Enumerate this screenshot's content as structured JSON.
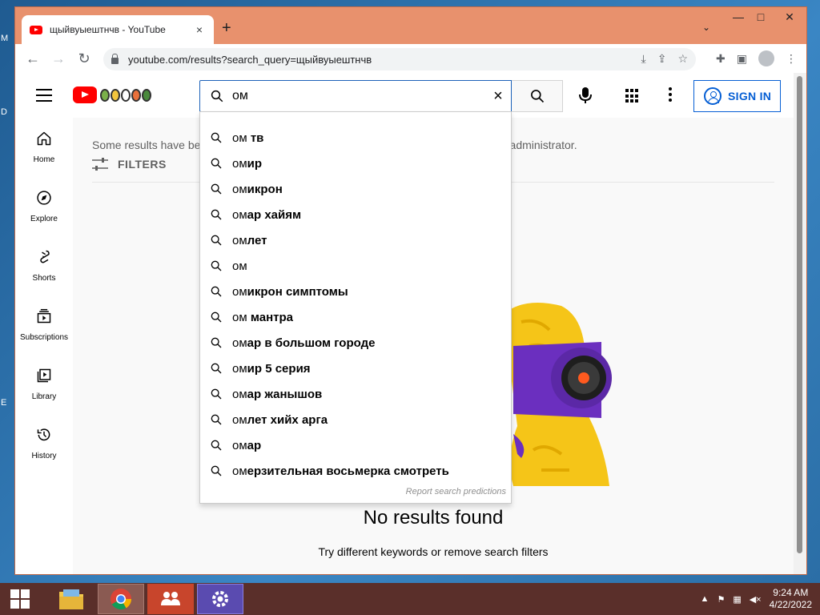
{
  "browser": {
    "tab_title": "щыйвуыештнчв - YouTube",
    "tab_close": "×",
    "new_tab": "+",
    "tab_search": "⌄",
    "url": "youtube.com/results?search_query=щыйвуыештнчв",
    "window_controls": {
      "minimize": "—",
      "maximize": "□",
      "close": "✕"
    }
  },
  "youtube": {
    "search": {
      "value": "ом",
      "clear": "×"
    },
    "signin_label": "SIGN IN",
    "guide": [
      {
        "label": "Home",
        "icon": "home-icon"
      },
      {
        "label": "Explore",
        "icon": "compass-icon"
      },
      {
        "label": "Shorts",
        "icon": "shorts-icon"
      },
      {
        "label": "Subscriptions",
        "icon": "subscriptions-icon"
      },
      {
        "label": "Library",
        "icon": "library-icon"
      },
      {
        "label": "History",
        "icon": "history-icon"
      }
    ],
    "notice_start": "Some results have be",
    "notice_end": "rk administrator.",
    "filters_label": "FILTERS",
    "no_results_title": "No results found",
    "no_results_sub": "Try different keywords or remove search filters",
    "suggestions": [
      {
        "prefix": "ом",
        "rest": " тв"
      },
      {
        "prefix": "ом",
        "rest": "ир"
      },
      {
        "prefix": "ом",
        "rest": "икрон"
      },
      {
        "prefix": "ом",
        "rest": "ар хайям"
      },
      {
        "prefix": "ом",
        "rest": "лет"
      },
      {
        "prefix": "ом",
        "rest": ""
      },
      {
        "prefix": "ом",
        "rest": "икрон симптомы"
      },
      {
        "prefix": "ом",
        "rest": " мантра"
      },
      {
        "prefix": "ом",
        "rest": "ар в большом городе"
      },
      {
        "prefix": "ом",
        "rest": "ир 5 серия"
      },
      {
        "prefix": "ом",
        "rest": "ар жанышов"
      },
      {
        "prefix": "ом",
        "rest": "лет хийх арга"
      },
      {
        "prefix": "ом",
        "rest": "ар"
      },
      {
        "prefix": "ом",
        "rest": "ерзительная восьмерка смотреть"
      }
    ],
    "report_predictions": "Report search predictions"
  },
  "taskbar": {
    "time": "9:24 AM",
    "date": "4/22/2022",
    "tray_up": "▲"
  },
  "colors": {
    "window_frame": "#e8916d",
    "taskbar": "#5a2f2a",
    "signin_blue": "#065fd4",
    "youtube_red": "#ff0000"
  }
}
